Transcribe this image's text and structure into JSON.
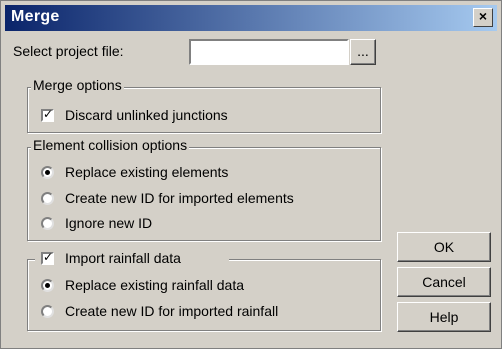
{
  "window": {
    "title": "Merge",
    "close_glyph": "×"
  },
  "project": {
    "label": "Select project file:",
    "value": "",
    "browse_label": "..."
  },
  "merge_options": {
    "legend": "Merge options",
    "discard_unlinked": {
      "label": "Discard unlinked junctions",
      "checked": true
    }
  },
  "collision": {
    "legend": "Element collision options",
    "options": [
      {
        "label": "Replace existing elements",
        "selected": true
      },
      {
        "label": "Create new ID for imported elements",
        "selected": false
      },
      {
        "label": "Ignore new ID",
        "selected": false
      }
    ]
  },
  "rainfall": {
    "legend_checkbox": {
      "label": "Import rainfall data",
      "checked": true
    },
    "options": [
      {
        "label": "Replace existing rainfall data",
        "selected": true
      },
      {
        "label": "Create new ID for imported rainfall",
        "selected": false
      }
    ]
  },
  "buttons": {
    "ok": "OK",
    "cancel": "Cancel",
    "help": "Help"
  }
}
